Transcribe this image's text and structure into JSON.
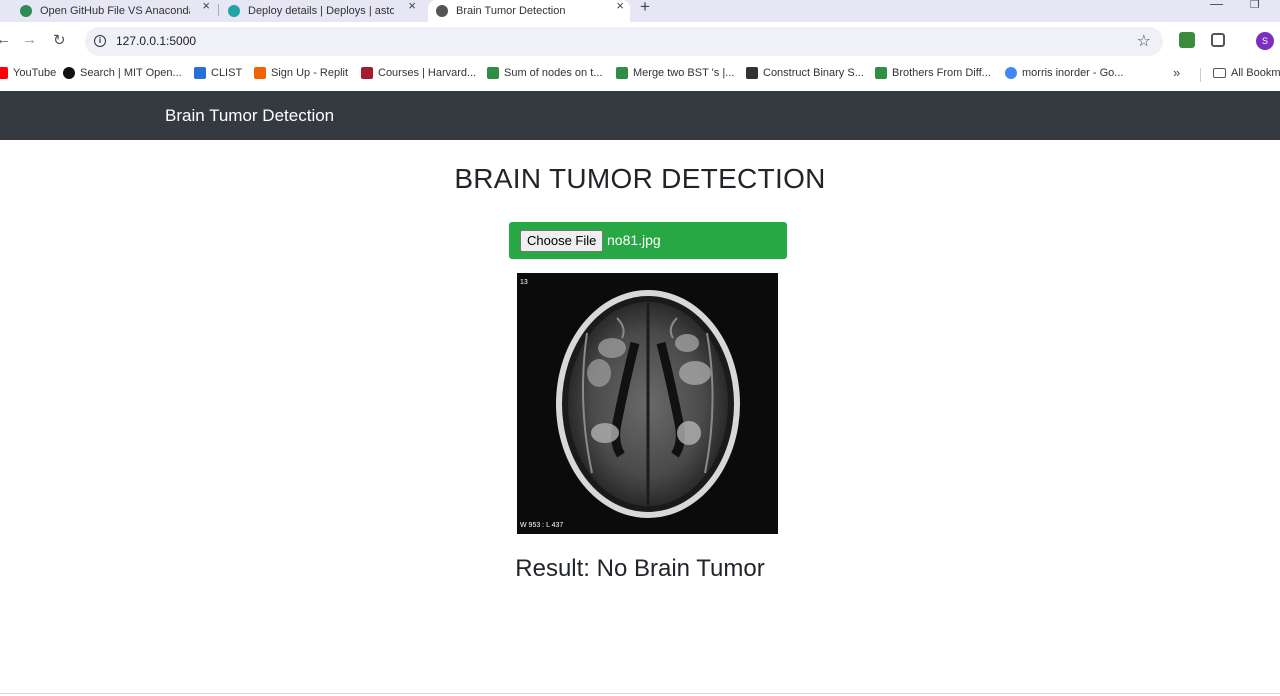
{
  "browser": {
    "tabs": [
      {
        "title": "Open GitHub File VS Anaconda",
        "active": false,
        "favicon_color": "#2e8b57"
      },
      {
        "title": "Deploy details | Deploys | astor",
        "active": false,
        "favicon_color": "#1fa3a3"
      },
      {
        "title": "Brain Tumor Detection",
        "active": true,
        "favicon_color": "#555555"
      }
    ],
    "new_tab_label": "+",
    "url": "127.0.0.1:5000",
    "avatar_letter": "S",
    "bookmarks": [
      {
        "label": "YouTube",
        "icon": "youtube-icon",
        "color": "#ff0000"
      },
      {
        "label": "Search | MIT Open...",
        "icon": "mit-icon",
        "color": "#111111"
      },
      {
        "label": "CLIST",
        "icon": "clist-icon",
        "color": "#2a6fd6"
      },
      {
        "label": "Sign Up - Replit",
        "icon": "replit-icon",
        "color": "#f26207"
      },
      {
        "label": "Courses | Harvard...",
        "icon": "harvard-icon",
        "color": "#a51c30"
      },
      {
        "label": "Sum of nodes on t...",
        "icon": "gfg-icon",
        "color": "#2f8d46"
      },
      {
        "label": "Merge two BST 's |...",
        "icon": "gfg-icon",
        "color": "#2f8d46"
      },
      {
        "label": "Construct Binary S...",
        "icon": "leetcode-icon",
        "color": "#333333"
      },
      {
        "label": "Brothers From Diff...",
        "icon": "gfg-icon",
        "color": "#2f8d46"
      },
      {
        "label": "morris inorder - Go...",
        "icon": "google-icon",
        "color": "#4285f4"
      }
    ],
    "all_bookmarks_label": "All Bookm"
  },
  "navbar": {
    "brand": "Brain Tumor Detection"
  },
  "main": {
    "heading": "BRAIN TUMOR DETECTION",
    "file_input": {
      "button_label": "Choose File",
      "file_name": "no81.jpg"
    },
    "mri_image": {
      "corner_label_top": "13",
      "corner_label_bottom": "W 953 : L 437"
    },
    "result": "Result: No Brain Tumor"
  },
  "colors": {
    "navbar": "#343a40",
    "upload_bg": "#28a745",
    "text": "#212529"
  }
}
